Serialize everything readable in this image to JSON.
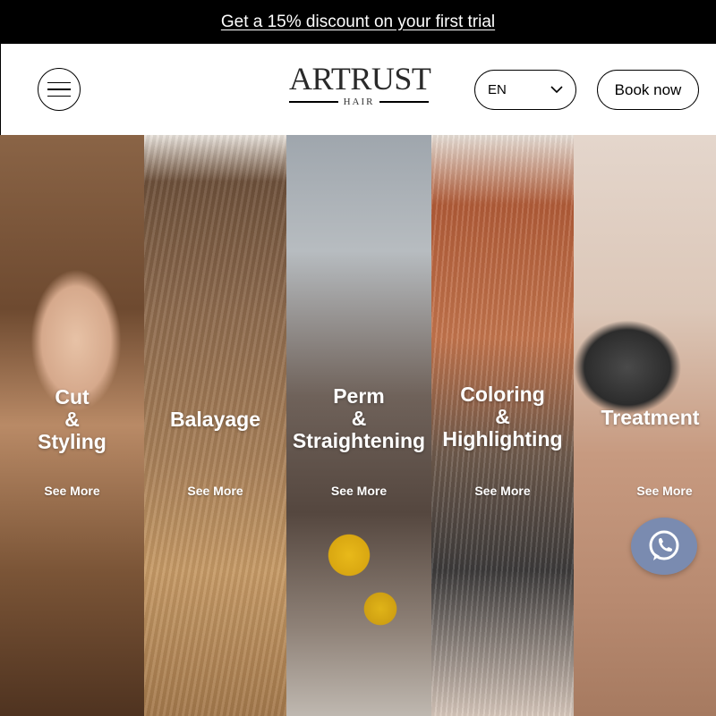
{
  "promo": {
    "text": "Get a 15% discount on your first trial"
  },
  "header": {
    "logo_main": "ARTRUST",
    "logo_sub": "HAIR",
    "language": "EN",
    "book_label": "Book now"
  },
  "services": [
    {
      "title_lines": [
        "Cut",
        "&",
        "Styling"
      ],
      "more": "See More"
    },
    {
      "title_lines": [
        "Balayage"
      ],
      "more": "See More"
    },
    {
      "title_lines": [
        "Perm",
        "&",
        "Straightening"
      ],
      "more": "See More"
    },
    {
      "title_lines": [
        "Coloring",
        "&",
        "Highlighting"
      ],
      "more": "See More"
    },
    {
      "title_lines": [
        "Treatment"
      ],
      "more": "See More"
    }
  ],
  "icons": {
    "menu": "hamburger-menu-icon",
    "language": "chevron-down-icon",
    "chat": "whatsapp-icon"
  },
  "colors": {
    "promo_bg": "#000000",
    "chat_button": "#7a8bb0"
  }
}
